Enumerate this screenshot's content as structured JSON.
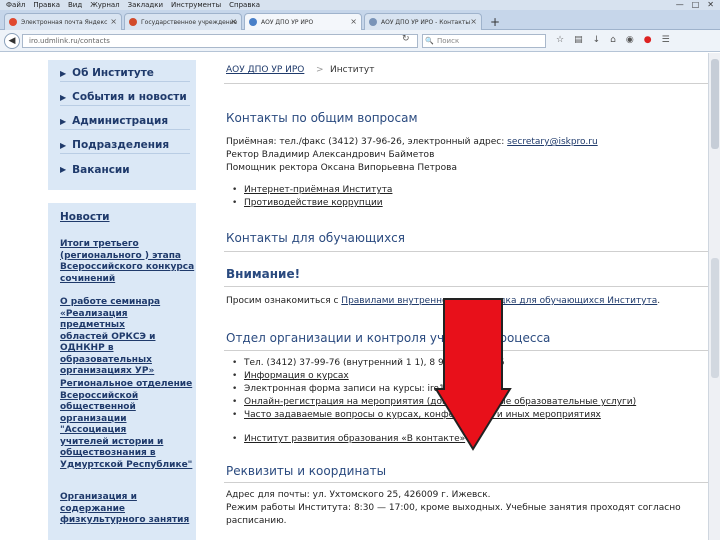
{
  "browser": {
    "menu": [
      "Файл",
      "Правка",
      "Вид",
      "Журнал",
      "Закладки",
      "Инструменты",
      "Справка"
    ],
    "tabs": [
      {
        "label": "Электронная почта Яндекс"
      },
      {
        "label": "Государственное учреждение"
      },
      {
        "label": "АОУ ДПО УР ИРО"
      },
      {
        "label": "АОУ ДПО УР ИРО - Контакты"
      }
    ],
    "url": "iro.udmlink.ru/contacts",
    "search_placeholder": "Поиск"
  },
  "sidebar": {
    "items": [
      {
        "label": "Об Институте"
      },
      {
        "label": "События и новости"
      },
      {
        "label": "Администрация"
      },
      {
        "label": "Подразделения"
      },
      {
        "label": "Вакансии"
      }
    ]
  },
  "news": {
    "title": "Новости",
    "items": [
      {
        "lines": [
          "Итоги третьего",
          "(регионального ) этапа",
          "Всероссийского конкурса",
          "сочинений"
        ]
      },
      {
        "lines": [
          "О работе семинара",
          "«Реализация предметных",
          "областей ОРКСЭ и",
          "ОДНКНР в",
          "образовательных",
          "организациях УР»"
        ]
      },
      {
        "lines": [
          "Региональное отделение",
          "Всероссийской",
          "общественной",
          "организации \"Ассоциация",
          "учителей истории и",
          "обществознания в",
          "Удмуртской Республике\""
        ]
      },
      {
        "lines": [
          "Организация и",
          "содержание",
          "физкультурного занятия"
        ]
      }
    ]
  },
  "breadcrumb": {
    "home": "АОУ ДПО УР ИРО",
    "sep": ">",
    "current": "Институт"
  },
  "sections": {
    "general": {
      "title": "Контакты по общим вопросам",
      "reception": "Приёмная: тел./факс (3412) 37-96-26, электронный адрес: ",
      "email": "secretary@iskpro.ru",
      "rector": "Ректор Владимир Александрович Байметов",
      "assistant": "Помощник ректора Оксана Випорьевна Петрова",
      "links": [
        "Интернет-приёмная Института",
        "Противодействие коррупции"
      ]
    },
    "students": {
      "title": "Контакты для обучающихся"
    },
    "attention": {
      "title": "Внимание!",
      "text_pre": "Просим ознакомиться с ",
      "text_link": "Правилами внутреннего распорядка для обучающихся Института",
      "text_post": "."
    },
    "department": {
      "title": "Отдел организации и контроля учебного процесса",
      "phone": "Тел. (3412) 37-99-76 (внутренний 1 1), 8 919 906-74-85",
      "links": [
        "Информация о курсах",
        "Электронная форма записи на курсы: iro18.ru/kursy",
        "Онлайн-регистрация на мероприятия (дополнительные образовательные услуги)",
        "Часто задаваемые вопросы о курсах, конференциях и иных мероприятиях",
        "Институт развития образования «В контакте»"
      ]
    },
    "requisites": {
      "title": "Реквизиты и координаты",
      "address": "Адрес для почты: ул. Ухтомского 25, 426009 г. Ижевск.",
      "hours": "Режим работы Института: 8:30 — 17:00, кроме выходных. Учебные занятия проходят согласно",
      "hours2": "расписанию."
    }
  },
  "colors": {
    "accent": "#1f3a6b",
    "sidebar_bg": "#dbe8f6",
    "arrow": "#e8101a"
  }
}
